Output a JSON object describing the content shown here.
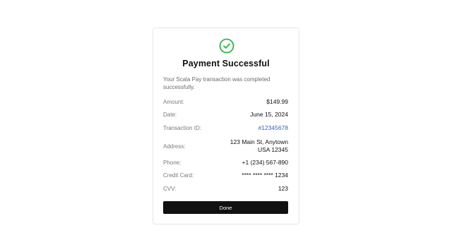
{
  "dialog": {
    "icon": "check-circle-icon",
    "title": "Payment Successful",
    "message": "Your Scala Pay transaction was completed successfully.",
    "colors": {
      "success": "#2eb34a",
      "link": "#2f62c4",
      "button": "#111111"
    },
    "details": {
      "amount": {
        "label": "Amount:",
        "value": "$149.99"
      },
      "date": {
        "label": "Date:",
        "value": "June 15, 2024"
      },
      "transaction_id": {
        "label": "Transaction ID:",
        "value": "#12345678"
      },
      "address": {
        "label": "Address:",
        "value": "123 Main St, Anytown\nUSA 12345"
      },
      "phone": {
        "label": "Phone:",
        "value": "+1 (234) 567-890"
      },
      "credit_card": {
        "label": "Credit Card:",
        "value": "**** **** **** 1234"
      },
      "cvv": {
        "label": "CVV:",
        "value": "123"
      }
    },
    "done_label": "Done"
  }
}
